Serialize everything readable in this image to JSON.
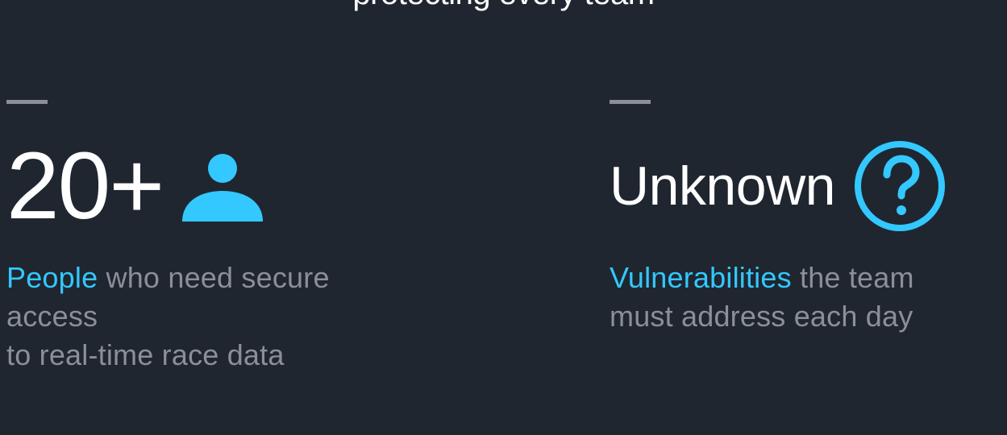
{
  "header": {
    "clipped_heading": "protecting every team"
  },
  "stats": [
    {
      "value": "20+",
      "icon": "person-icon",
      "highlight": "People",
      "text_line1": " who need secure access",
      "text_line2": "to real-time race data"
    },
    {
      "value": "Unknown",
      "icon": "question-circle-icon",
      "highlight": "Vulnerabilities",
      "text_line1": " the team",
      "text_line2": "must address each day"
    }
  ],
  "colors": {
    "background": "#1f2630",
    "accent": "#33c8ff",
    "muted": "#8a8f99",
    "foreground": "#ffffff"
  }
}
